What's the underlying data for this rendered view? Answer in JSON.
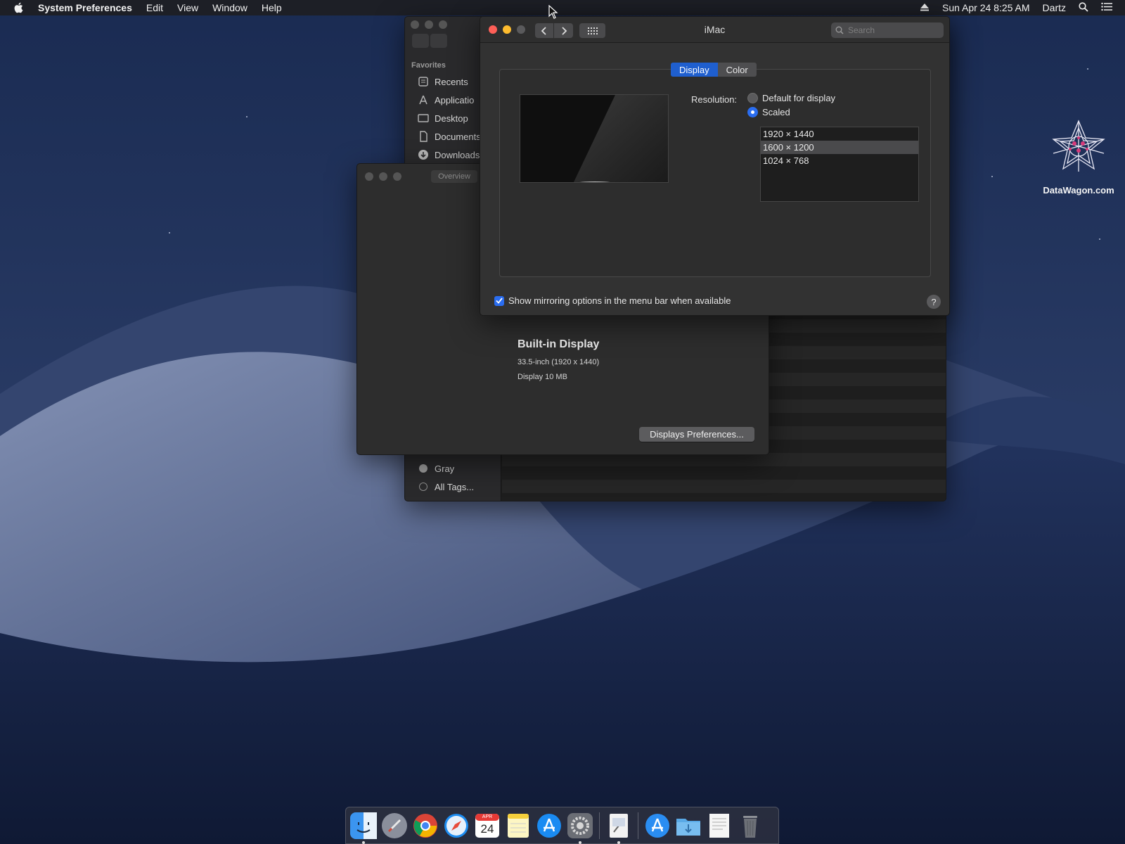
{
  "menubar": {
    "app_name": "System Preferences",
    "menus": [
      "Edit",
      "View",
      "Window",
      "Help"
    ],
    "datetime": "Sun Apr 24  8:25 AM",
    "user": "Dartz"
  },
  "finder": {
    "favorites_title": "Favorites",
    "favorites": [
      "Recents",
      "Applicatio",
      "Desktop",
      "Documents",
      "Downloads"
    ],
    "tags": [
      "Gray",
      "All Tags..."
    ]
  },
  "about": {
    "tab_overview": "Overview",
    "display_name": "Built-in Display",
    "display_size": "33.5-inch (1920 x 1440)",
    "display_memory": "Display 10 MB",
    "button_label": "Displays Preferences..."
  },
  "prefs": {
    "window_title": "iMac",
    "search_placeholder": "Search",
    "tabs": [
      "Display",
      "Color"
    ],
    "active_tab": "Display",
    "resolution_label": "Resolution:",
    "options": [
      "Default for display",
      "Scaled"
    ],
    "selected_option": "Scaled",
    "resolutions": [
      "1920 × 1440",
      "1600 × 1200",
      "1024 × 768"
    ],
    "selected_resolution": "1600 × 1200",
    "mirroring_label": "Show mirroring options in the menu bar when available",
    "mirroring_checked": true,
    "help_label": "?"
  },
  "watermark": {
    "text": "DataWagon.com"
  },
  "dock": {
    "apps": [
      "finder",
      "launchpad",
      "chrome",
      "safari",
      "calendar",
      "notes",
      "app-store",
      "system-preferences",
      "preview",
      "app-store-folder",
      "downloads-folder",
      "document",
      "trash"
    ],
    "calendar_month": "APR",
    "calendar_day": "24"
  },
  "colors": {
    "accent": "#2a6df0",
    "close": "#fe5f57",
    "minimize": "#febc2e",
    "zoom": "#5a5a5c"
  }
}
